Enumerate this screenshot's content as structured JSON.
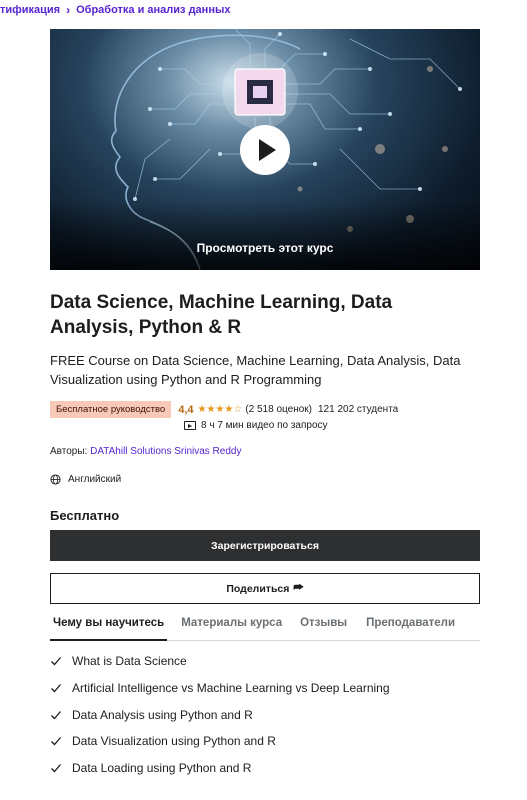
{
  "breadcrumb": {
    "items": [
      "тификация",
      "Обработка и анализ данных"
    ],
    "separator": "›"
  },
  "hero": {
    "preview_label": "Просмотреть этот курс",
    "play_icon": "play-icon"
  },
  "course": {
    "title": "Data Science, Machine Learning, Data Analysis, Python & R",
    "subtitle": "FREE Course on Data Science, Machine Learning, Data Analysis, Data Visualization using Python and R Programming",
    "badge": "Бесплатное руководство",
    "rating": "4,4",
    "rating_value": 4.4,
    "stars": "★★★★☆",
    "reviews": "(2 518 оценок)",
    "students": "121 202 студента",
    "duration": "8 ч 7 мин видео по запросу",
    "authors_label": "Авторы:",
    "authors": "DATAhill Solutions Srinivas Reddy",
    "language": "Английский",
    "price": "Бесплатно"
  },
  "actions": {
    "register_label": "Зарегистрироваться",
    "share_label": "Поделиться",
    "share_arrow": "⮫"
  },
  "tabs": [
    "Чему вы научитесь",
    "Материалы курса",
    "Отзывы",
    "Преподаватели"
  ],
  "learn": [
    "What is Data Science",
    "Artificial Intelligence vs Machine Learning vs Deep Learning",
    "Data Analysis using Python and R",
    "Data Visualization using Python and R",
    "Data Loading using Python and R"
  ],
  "colors": {
    "accent": "#5624d0",
    "badge_bg": "#f7c9b6",
    "rating": "#b4690e",
    "stars": "#e59819",
    "button_dark": "#2d2f31"
  }
}
